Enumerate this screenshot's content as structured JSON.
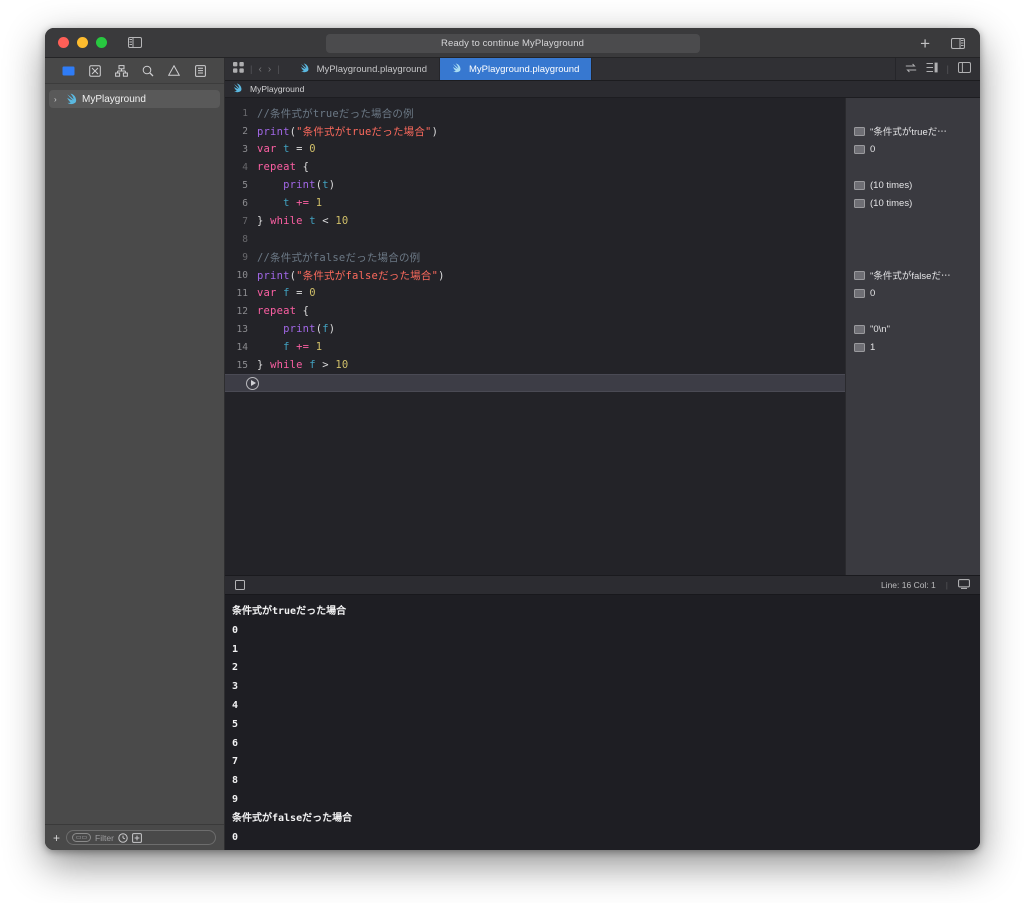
{
  "window": {
    "status_text": "Ready to continue MyPlayground",
    "traffic_lights": [
      "close",
      "minimize",
      "zoom"
    ],
    "sidebar_toggle_icon": "sidebar-toggle-icon",
    "add_button_label": "+",
    "inspector_toggle_icon": "inspector-toggle-icon"
  },
  "navigator": {
    "toolbar_icons": [
      {
        "name": "folder-icon",
        "active": true
      },
      {
        "name": "source-control-icon",
        "active": false
      },
      {
        "name": "symbol-hierarchy-icon",
        "active": false
      },
      {
        "name": "search-icon",
        "active": false
      },
      {
        "name": "issue-warning-icon",
        "active": false
      },
      {
        "name": "report-icon",
        "active": false
      }
    ],
    "tree": [
      {
        "label": "MyPlayground",
        "icon": "swift-playground-icon",
        "disclosure": "›",
        "selected": true
      }
    ],
    "filter": {
      "plus_label": "+",
      "placeholder": "Filter",
      "pill_label": "▭▭",
      "recent_icon": "clock-icon",
      "add_icon": "add-box-icon"
    }
  },
  "tabbar": {
    "grid_icon": "tab-grid-icon",
    "back_icon": "‹",
    "forward_icon": "›",
    "tabs": [
      {
        "label": "MyPlayground.playground",
        "icon": "swift-playground-icon",
        "active": false
      },
      {
        "label": "MyPlayground.playground",
        "icon": "swift-playground-icon",
        "active": true
      }
    ],
    "right_icons": [
      {
        "name": "assistant-editor-icon"
      },
      {
        "name": "editor-options-icon"
      },
      {
        "name": "inspector-panel-icon"
      }
    ]
  },
  "jumpbar": {
    "items": [
      "MyPlayground"
    ],
    "icon": "swift-playground-icon"
  },
  "editor": {
    "lines": [
      {
        "num": "1",
        "dim": true,
        "tokens": [
          {
            "t": "//条件式がtrueだった場合の例",
            "c": "comment"
          }
        ]
      },
      {
        "num": "2",
        "dim": false,
        "tokens": [
          {
            "t": "print",
            "c": "fn"
          },
          {
            "t": "(",
            "c": "plain"
          },
          {
            "t": "\"条件式がtrueだった場合\"",
            "c": "str"
          },
          {
            "t": ")",
            "c": "plain"
          }
        ]
      },
      {
        "num": "3",
        "dim": false,
        "tokens": [
          {
            "t": "var",
            "c": "kw"
          },
          {
            "t": " ",
            "c": "plain"
          },
          {
            "t": "t",
            "c": "var"
          },
          {
            "t": " = ",
            "c": "plain"
          },
          {
            "t": "0",
            "c": "num"
          }
        ]
      },
      {
        "num": "4",
        "dim": true,
        "tokens": [
          {
            "t": "repeat",
            "c": "kw"
          },
          {
            "t": " {",
            "c": "plain"
          }
        ]
      },
      {
        "num": "5",
        "dim": false,
        "tokens": [
          {
            "t": "    ",
            "c": "plain"
          },
          {
            "t": "print",
            "c": "fn"
          },
          {
            "t": "(",
            "c": "plain"
          },
          {
            "t": "t",
            "c": "var"
          },
          {
            "t": ")",
            "c": "plain"
          }
        ]
      },
      {
        "num": "6",
        "dim": false,
        "tokens": [
          {
            "t": "    ",
            "c": "plain"
          },
          {
            "t": "t",
            "c": "var"
          },
          {
            "t": " ",
            "c": "plain"
          },
          {
            "t": "+=",
            "c": "kw"
          },
          {
            "t": " ",
            "c": "plain"
          },
          {
            "t": "1",
            "c": "num"
          }
        ]
      },
      {
        "num": "7",
        "dim": true,
        "tokens": [
          {
            "t": "}",
            "c": "plain"
          },
          {
            "t": " ",
            "c": "plain"
          },
          {
            "t": "while",
            "c": "kw"
          },
          {
            "t": " ",
            "c": "plain"
          },
          {
            "t": "t",
            "c": "var"
          },
          {
            "t": " < ",
            "c": "plain"
          },
          {
            "t": "10",
            "c": "num"
          }
        ]
      },
      {
        "num": "8",
        "dim": true,
        "tokens": []
      },
      {
        "num": "9",
        "dim": true,
        "tokens": [
          {
            "t": "//条件式がfalseだった場合の例",
            "c": "comment"
          }
        ]
      },
      {
        "num": "10",
        "dim": false,
        "tokens": [
          {
            "t": "print",
            "c": "fn"
          },
          {
            "t": "(",
            "c": "plain"
          },
          {
            "t": "\"条件式がfalseだった場合\"",
            "c": "str"
          },
          {
            "t": ")",
            "c": "plain"
          }
        ]
      },
      {
        "num": "11",
        "dim": false,
        "tokens": [
          {
            "t": "var",
            "c": "kw"
          },
          {
            "t": " ",
            "c": "plain"
          },
          {
            "t": "f",
            "c": "var"
          },
          {
            "t": " = ",
            "c": "plain"
          },
          {
            "t": "0",
            "c": "num"
          }
        ]
      },
      {
        "num": "12",
        "dim": false,
        "tokens": [
          {
            "t": "repeat",
            "c": "kw"
          },
          {
            "t": " {",
            "c": "plain"
          }
        ]
      },
      {
        "num": "13",
        "dim": false,
        "tokens": [
          {
            "t": "    ",
            "c": "plain"
          },
          {
            "t": "print",
            "c": "fn"
          },
          {
            "t": "(",
            "c": "plain"
          },
          {
            "t": "f",
            "c": "var"
          },
          {
            "t": ")",
            "c": "plain"
          }
        ]
      },
      {
        "num": "14",
        "dim": false,
        "tokens": [
          {
            "t": "    ",
            "c": "plain"
          },
          {
            "t": "f",
            "c": "var"
          },
          {
            "t": " ",
            "c": "plain"
          },
          {
            "t": "+=",
            "c": "kw"
          },
          {
            "t": " ",
            "c": "plain"
          },
          {
            "t": "1",
            "c": "num"
          }
        ]
      },
      {
        "num": "15",
        "dim": false,
        "tokens": [
          {
            "t": "}",
            "c": "plain"
          },
          {
            "t": " ",
            "c": "plain"
          },
          {
            "t": "while",
            "c": "kw"
          },
          {
            "t": " ",
            "c": "plain"
          },
          {
            "t": "f",
            "c": "var"
          },
          {
            "t": " > ",
            "c": "plain"
          },
          {
            "t": "10",
            "c": "num"
          }
        ]
      }
    ],
    "execute_button": "run-playground-button"
  },
  "results": [
    {
      "line": 1,
      "text": ""
    },
    {
      "line": 2,
      "text": "\"条件式がtrueだ⋯"
    },
    {
      "line": 3,
      "text": "0"
    },
    {
      "line": 4,
      "text": ""
    },
    {
      "line": 5,
      "text": "(10 times)"
    },
    {
      "line": 6,
      "text": "(10 times)"
    },
    {
      "line": 7,
      "text": ""
    },
    {
      "line": 8,
      "text": ""
    },
    {
      "line": 9,
      "text": ""
    },
    {
      "line": 10,
      "text": "\"条件式がfalseだ⋯"
    },
    {
      "line": 11,
      "text": "0"
    },
    {
      "line": 12,
      "text": ""
    },
    {
      "line": 13,
      "text": "\"0\\n\""
    },
    {
      "line": 14,
      "text": "1"
    },
    {
      "line": 15,
      "text": ""
    }
  ],
  "debugbar": {
    "toggle_icon": "console-toggle-icon",
    "line_col": "Line: 16  Col: 1",
    "separator": "|",
    "console_icon": "console-panel-icon"
  },
  "console": {
    "lines": [
      "条件式がtrueだった場合",
      "0",
      "1",
      "2",
      "3",
      "4",
      "5",
      "6",
      "7",
      "8",
      "9",
      "条件式がfalseだった場合",
      "0"
    ]
  },
  "colors": {
    "accent": "#3778d0",
    "editor_bg": "#232328",
    "console_bg": "#1e1e23",
    "navigator_bg": "#4a4a4a",
    "results_bg": "#3a3a40",
    "syntax_comment": "#6c7986",
    "syntax_function": "#a167e6",
    "syntax_string": "#fc6a5d",
    "syntax_keyword": "#fc5fa3",
    "syntax_number": "#d0bf69",
    "syntax_variable": "#41a1c0"
  }
}
